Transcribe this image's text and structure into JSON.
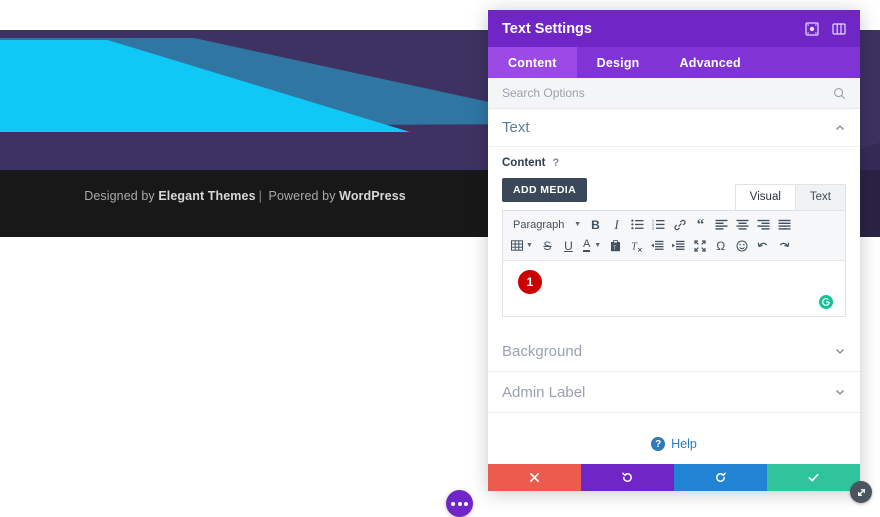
{
  "background_page": {
    "footer": {
      "prefix": "Designed by ",
      "brand": "Elegant Themes",
      "separator": "|",
      "middle": " Powered by ",
      "platform": "WordPress"
    },
    "fab": {
      "name": "page-settings-button",
      "icon": "ellipsis-icon"
    },
    "colors": {
      "hero_bg": "#3e3262",
      "hero_cyan": "#0fc8f5",
      "hero_blue": "#2f7ca8",
      "footer_bg": "#181818",
      "fab": "#7026c7"
    }
  },
  "modal": {
    "title": "Text Settings",
    "header_icons": [
      {
        "name": "expand-icon",
        "label": "Expand"
      },
      {
        "name": "layout-panel-icon",
        "label": "Layout"
      }
    ],
    "tabs": [
      {
        "label": "Content",
        "active": true
      },
      {
        "label": "Design",
        "active": false
      },
      {
        "label": "Advanced",
        "active": false
      }
    ],
    "search": {
      "placeholder": "Search Options",
      "value": "",
      "icon": "search-icon"
    },
    "sections": [
      {
        "label": "Text",
        "expanded": true,
        "chevron": "chevron-up-icon"
      },
      {
        "label": "Background",
        "expanded": false,
        "chevron": "chevron-down-icon"
      },
      {
        "label": "Admin Label",
        "expanded": false,
        "chevron": "chevron-down-icon"
      }
    ],
    "content_field": {
      "label": "Content",
      "help_marker": "?",
      "add_media_label": "ADD MEDIA",
      "editor_tabs": [
        {
          "label": "Visual",
          "active": true
        },
        {
          "label": "Text",
          "active": false
        }
      ],
      "format_select": {
        "value": "Paragraph",
        "caret": "caret-down-icon"
      },
      "toolbar_row_1": [
        {
          "name": "bold-icon",
          "glyph": "B"
        },
        {
          "name": "italic-icon",
          "glyph": "I"
        },
        {
          "name": "bulleted-list-icon",
          "glyph": ""
        },
        {
          "name": "numbered-list-icon",
          "glyph": ""
        },
        {
          "name": "link-icon",
          "glyph": ""
        },
        {
          "name": "blockquote-icon",
          "glyph": "“"
        },
        {
          "name": "align-left-icon",
          "glyph": ""
        },
        {
          "name": "align-center-icon",
          "glyph": ""
        },
        {
          "name": "align-right-icon",
          "glyph": ""
        },
        {
          "name": "align-justify-icon",
          "glyph": ""
        }
      ],
      "toolbar_row_2": [
        {
          "name": "table-icon",
          "glyph": ""
        },
        {
          "name": "strikethrough-icon",
          "glyph": "S"
        },
        {
          "name": "underline-icon",
          "glyph": "U"
        },
        {
          "name": "text-color-icon",
          "glyph": "A"
        },
        {
          "name": "paste-as-text-icon",
          "glyph": ""
        },
        {
          "name": "clear-formatting-icon",
          "glyph": ""
        },
        {
          "name": "outdent-icon",
          "glyph": ""
        },
        {
          "name": "indent-icon",
          "glyph": ""
        },
        {
          "name": "fullscreen-icon",
          "glyph": ""
        },
        {
          "name": "special-character-icon",
          "glyph": "Ω"
        },
        {
          "name": "emoji-icon",
          "glyph": "☺"
        },
        {
          "name": "undo-icon",
          "glyph": "↶"
        },
        {
          "name": "redo-icon",
          "glyph": "↷"
        }
      ],
      "editor_value": "",
      "step_badge": "1",
      "grammarly_icon": "grammarly-icon"
    },
    "help": {
      "badge": "?",
      "label": "Help"
    },
    "actions": [
      {
        "name": "cancel-button",
        "icon": "close-icon",
        "glyph": "✖",
        "color": "#ec5c4e"
      },
      {
        "name": "undo-button",
        "icon": "undo-icon",
        "glyph": "↺",
        "color": "#7026c7"
      },
      {
        "name": "redo-button",
        "icon": "redo-icon",
        "glyph": "↻",
        "color": "#2183d4"
      },
      {
        "name": "save-button",
        "icon": "check-icon",
        "glyph": "✔",
        "color": "#2fc49c"
      }
    ],
    "resize_handle": {
      "name": "resize-handle",
      "icon": "resize-diagonal-icon"
    }
  }
}
